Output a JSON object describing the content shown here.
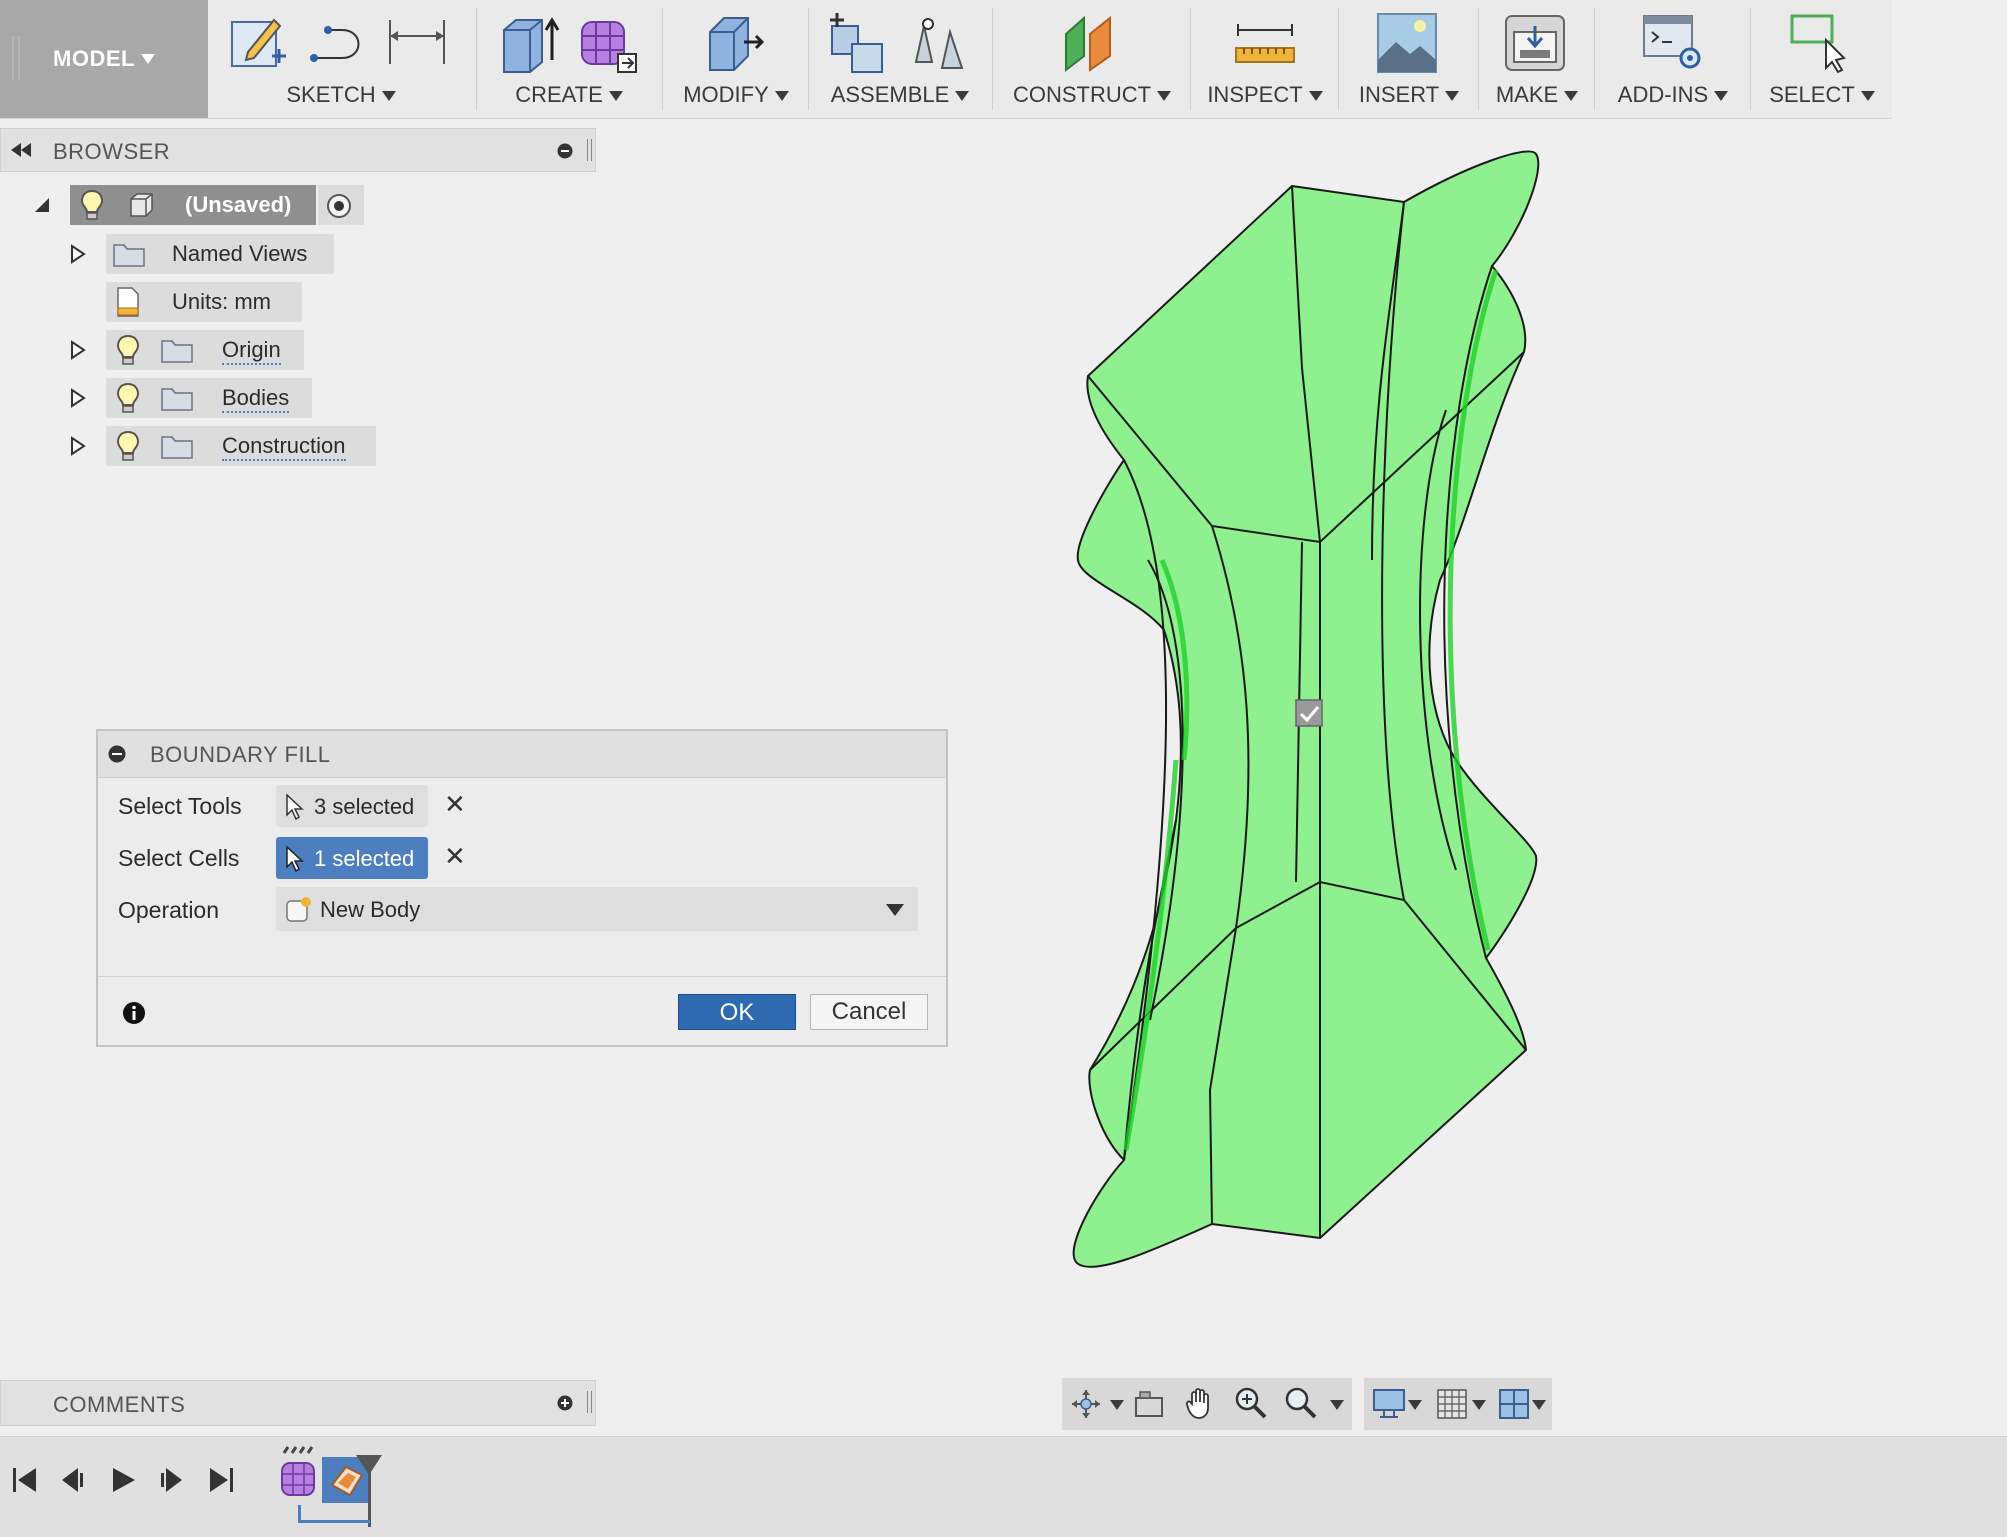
{
  "toolbar": {
    "workspace": "MODEL",
    "groups": [
      {
        "label": "SKETCH"
      },
      {
        "label": "CREATE"
      },
      {
        "label": "MODIFY"
      },
      {
        "label": "ASSEMBLE"
      },
      {
        "label": "CONSTRUCT"
      },
      {
        "label": "INSPECT"
      },
      {
        "label": "INSERT"
      },
      {
        "label": "MAKE"
      },
      {
        "label": "ADD-INS"
      },
      {
        "label": "SELECT"
      }
    ]
  },
  "browser": {
    "title": "BROWSER",
    "root": "(Unsaved)",
    "items": [
      {
        "label": "Named Views"
      },
      {
        "label": "Units: mm"
      },
      {
        "label": "Origin"
      },
      {
        "label": "Bodies"
      },
      {
        "label": "Construction"
      }
    ]
  },
  "dialog": {
    "title": "BOUNDARY FILL",
    "rows": [
      {
        "label": "Select Tools",
        "value": "3 selected"
      },
      {
        "label": "Select Cells",
        "value": "1 selected"
      },
      {
        "label": "Operation",
        "value": "New Body"
      }
    ],
    "ok": "OK",
    "cancel": "Cancel"
  },
  "comments": {
    "title": "COMMENTS"
  },
  "colors": {
    "selection": "#4d7fc0",
    "ok": "#2f69b0",
    "body_fill": "#8ef08e",
    "body_edge": "#1a1a1a"
  }
}
